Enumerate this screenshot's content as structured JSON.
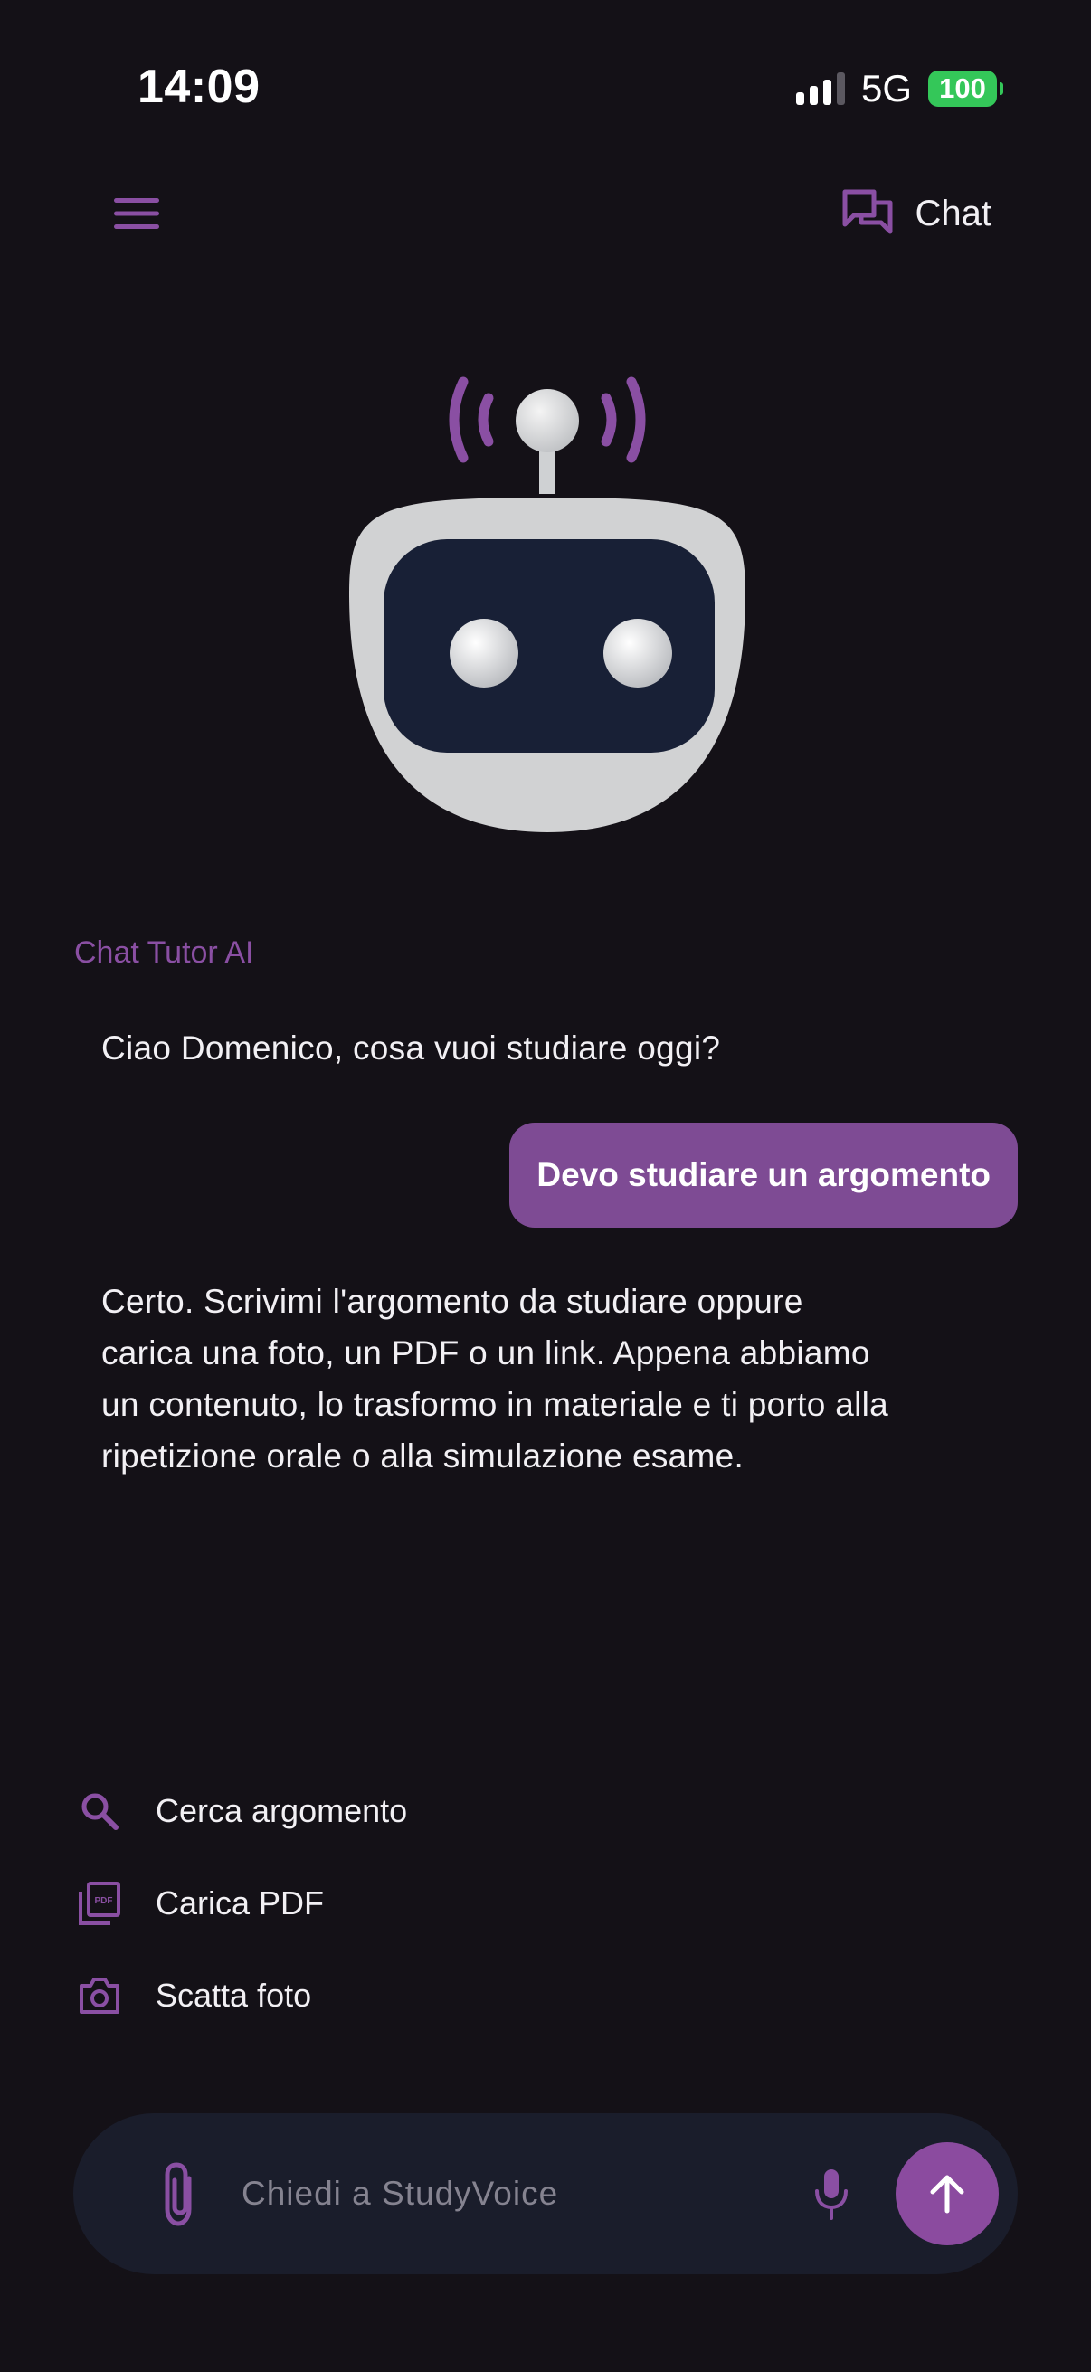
{
  "status_bar": {
    "time": "14:09",
    "network": "5G",
    "battery": "100"
  },
  "header": {
    "menu_icon": "hamburger-menu-icon",
    "chat_icon": "chat-bubbles-icon",
    "chat_label": "Chat"
  },
  "avatar": {
    "icon": "robot-broadcasting-icon"
  },
  "chat": {
    "sender_label": "Chat Tutor AI",
    "messages": [
      {
        "role": "assistant",
        "text": "Ciao Domenico, cosa vuoi studiare oggi?"
      },
      {
        "role": "user",
        "text": "Devo studiare un argomento"
      },
      {
        "role": "assistant",
        "text": "Certo. Scrivimi l'argomento da studiare oppure carica una foto, un PDF o un link. Appena abbiamo un contenuto, lo trasformo in materiale e ti porto alla ripetizione orale o alla simulazione esame."
      }
    ]
  },
  "actions": [
    {
      "icon": "search-icon",
      "label": "Cerca argomento"
    },
    {
      "icon": "pdf-icon",
      "label": "Carica PDF"
    },
    {
      "icon": "camera-icon",
      "label": "Scatta foto"
    }
  ],
  "composer": {
    "placeholder": "Chiedi a StudyVoice",
    "value": "",
    "attach_icon": "paperclip-icon",
    "mic_icon": "microphone-icon",
    "send_icon": "arrow-up-icon"
  },
  "colors": {
    "background": "#141117",
    "accent": "#8b4b9f",
    "user_bubble": "#7e4b94",
    "composer": "#1a1d2b",
    "battery": "#34c759"
  }
}
